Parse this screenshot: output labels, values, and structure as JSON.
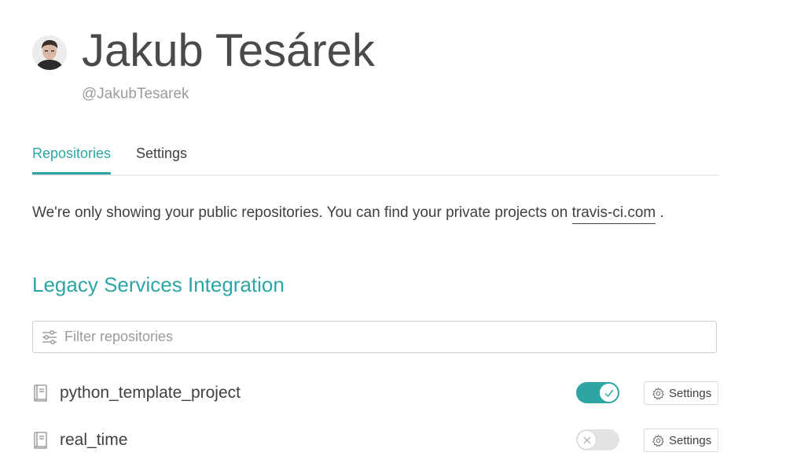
{
  "profile": {
    "name": "Jakub Tesárek",
    "login": "@JakubTesarek"
  },
  "tabs": [
    {
      "label": "Repositories",
      "active": true
    },
    {
      "label": "Settings",
      "active": false
    }
  ],
  "info": {
    "text": "We're only showing your public repositories. You can find your private projects on ",
    "link_text": "travis-ci.com",
    "suffix": " ."
  },
  "section": {
    "title": "Legacy Services Integration"
  },
  "filter": {
    "placeholder": "Filter repositories",
    "value": ""
  },
  "repositories": [
    {
      "name": "python_template_project",
      "enabled": true,
      "settings_label": "Settings"
    },
    {
      "name": "real_time",
      "enabled": false,
      "settings_label": "Settings"
    }
  ],
  "colors": {
    "accent": "#2ea5a5",
    "text": "#404040",
    "muted": "#9b9b9b"
  }
}
